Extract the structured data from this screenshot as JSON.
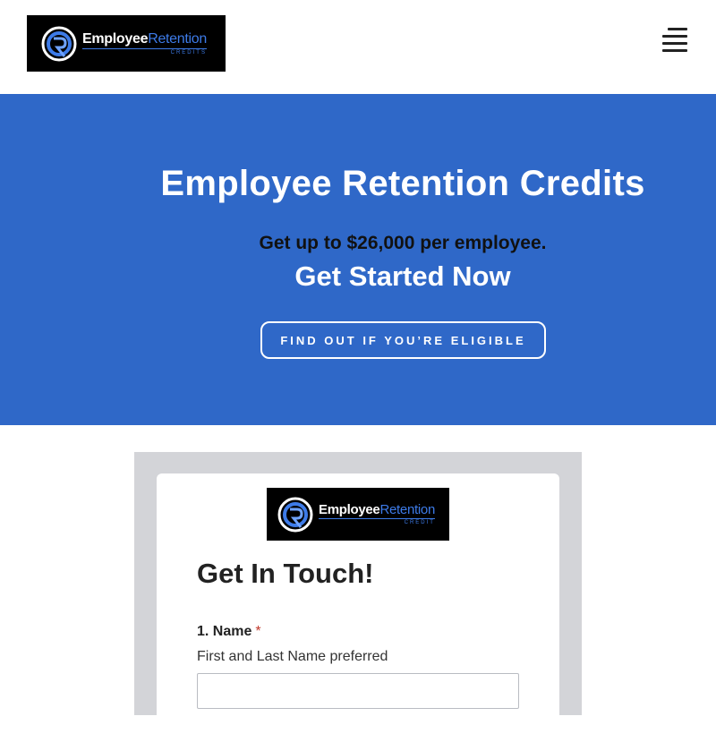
{
  "header": {
    "logo": {
      "word_main": "Employee",
      "word_accent": "Retention",
      "sub": "CREDITS"
    },
    "menu_icon": "hamburger-menu-icon"
  },
  "hero": {
    "title": "Employee Retention Credits",
    "tagline": "Get up to $26,000 per employee.",
    "cta_text": "Get Started Now",
    "button_label": "FIND OUT IF YOU’RE ELIGIBLE",
    "background_color": "#2f68c8"
  },
  "form": {
    "logo": {
      "word_main": "Employee",
      "word_accent": "Retention",
      "sub": "CREDIT"
    },
    "title": "Get In Touch!",
    "name_field": {
      "label": "1. Name",
      "required_mark": "*",
      "help": "First and Last Name preferred",
      "value": ""
    }
  },
  "colors": {
    "brand_blue": "#2f68c8",
    "logo_accent": "#3d7be8",
    "required": "#c0392b"
  }
}
